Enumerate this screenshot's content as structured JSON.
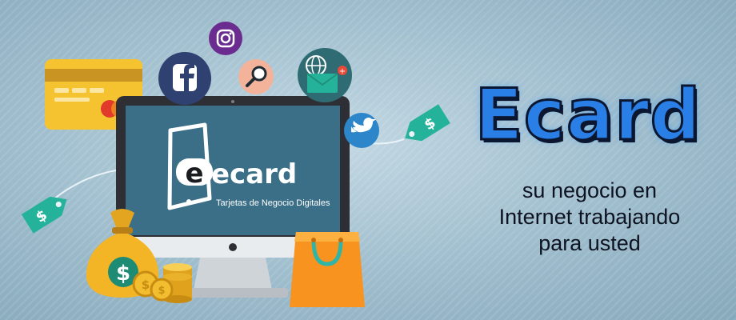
{
  "brand": {
    "headline": "Ecard",
    "tagline_lines": [
      "su negocio en",
      "Internet trabajando",
      "para usted"
    ],
    "logo_wordmark": "ecard",
    "logo_subtitle": "Tarjetas de Negocio Digitales"
  },
  "decorations": {
    "icons": [
      "credit-card-icon",
      "facebook-icon",
      "instagram-icon",
      "search-icon",
      "web-mail-icon",
      "twitter-icon",
      "price-tag-icon",
      "money-bag-icon",
      "coin-stack-icon",
      "shopping-bag-icon"
    ]
  },
  "colors": {
    "headline": "#2a7fe6",
    "monitor_screen": "#3a6f87",
    "accent_teal": "#24b39a"
  }
}
